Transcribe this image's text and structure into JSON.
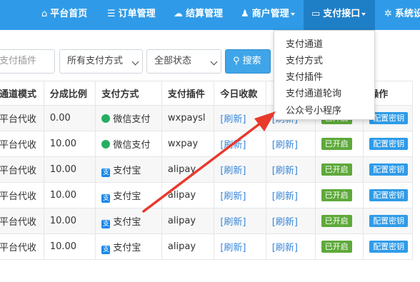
{
  "nav": {
    "items": [
      {
        "icon": "home-icon",
        "label": "平台首页"
      },
      {
        "icon": "list-icon",
        "label": "订单管理"
      },
      {
        "icon": "cloud-icon",
        "label": "结算管理"
      },
      {
        "icon": "user-icon",
        "label": "商户管理"
      },
      {
        "icon": "card-icon",
        "label": "支付接口"
      },
      {
        "icon": "gear-icon",
        "label": "系统设"
      }
    ],
    "colors": {
      "bar": "#2f9be8",
      "active": "#1f7fc6"
    }
  },
  "filters": {
    "plugin_placeholder": "支付插件",
    "method_selected": "所有支付方式",
    "status_selected": "全部状态",
    "search_label": "搜索"
  },
  "dropdown": {
    "items": [
      "支付通道",
      "支付方式",
      "支付插件",
      "支付通道轮询",
      "公众号小程序"
    ]
  },
  "table": {
    "headers": [
      "通道模式",
      "分成比例",
      "支付方式",
      "支付插件",
      "今日收款",
      "",
      "",
      "操作"
    ],
    "rows": [
      {
        "mode": "平台代收",
        "ratio": "0.00",
        "method": "微信支付",
        "method_icon": "wechat-icon",
        "plugin": "wxpaysl",
        "today": "[刷新]",
        "yesterday": "[刷新]",
        "status": "已开启",
        "action": "配置密钥"
      },
      {
        "mode": "平台代收",
        "ratio": "10.00",
        "method": "微信支付",
        "method_icon": "wechat-icon",
        "plugin": "wxpay",
        "today": "[刷新]",
        "yesterday": "[刷新]",
        "status": "已开启",
        "action": "配置密钥"
      },
      {
        "mode": "平台代收",
        "ratio": "10.00",
        "method": "支付宝",
        "method_icon": "alipay-icon",
        "plugin": "alipay",
        "today": "[刷新]",
        "yesterday": "[刷新]",
        "status": "已开启",
        "action": "配置密钥"
      },
      {
        "mode": "平台代收",
        "ratio": "10.00",
        "method": "支付宝",
        "method_icon": "alipay-icon",
        "plugin": "alipay",
        "today": "[刷新]",
        "yesterday": "[刷新]",
        "status": "已开启",
        "action": "配置密钥"
      },
      {
        "mode": "平台代收",
        "ratio": "10.00",
        "method": "支付宝",
        "method_icon": "alipay-icon",
        "plugin": "alipay",
        "today": "[刷新]",
        "yesterday": "[刷新]",
        "status": "已开启",
        "action": "配置密钥"
      },
      {
        "mode": "平台代收",
        "ratio": "10.00",
        "method": "支付宝",
        "method_icon": "alipay-icon",
        "plugin": "alipay",
        "today": "[刷新]",
        "yesterday": "[刷新]",
        "status": "已开启",
        "action": "配置密钥"
      }
    ]
  },
  "annotation": {
    "arrow_color": "#e8392b"
  }
}
